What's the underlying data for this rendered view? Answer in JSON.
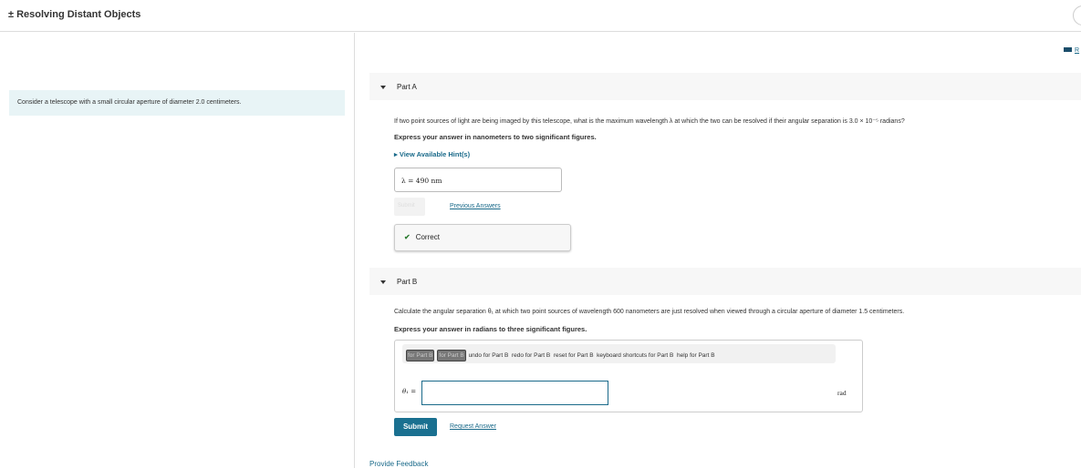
{
  "header": {
    "title": "± Resolving Distant Objects"
  },
  "intro": "Consider a telescope with a small circular aperture of diameter 2.0 centimeters.",
  "resources_link": "R",
  "partA": {
    "label": "Part A",
    "question": "If two point sources of light are being imaged by this telescope, what is the maximum wavelength λ at which the two can be resolved if their angular separation is 3.0 × 10⁻⁵ radians?",
    "instruction": "Express your answer in nanometers to two significant figures.",
    "hint": "View Available Hint(s)",
    "answer": "λ =  490  nm",
    "submit": "Submit",
    "previous": "Previous Answers",
    "status": "Correct"
  },
  "partB": {
    "label": "Part B",
    "question": "Calculate the angular separation θ₁ at which two point sources of wavelength 600 nanometers are just resolved when viewed through a circular aperture of diameter 1.5 centimeters.",
    "instruction": "Express your answer in radians to three significant figures.",
    "toolbar": [
      "for Part B",
      "for Part B",
      "undo for Part B",
      "redo for Part B",
      "reset for Part B",
      "keyboard shortcuts for Part B",
      "help for Part B"
    ],
    "var_label": "θ₁ =",
    "input_value": "",
    "unit": "rad",
    "submit": "Submit",
    "request": "Request Answer"
  },
  "feedback": "Provide Feedback",
  "colors": {
    "accent": "#1a7090",
    "correct": "#2e7d32",
    "intro_bg": "#e8f4f6"
  }
}
